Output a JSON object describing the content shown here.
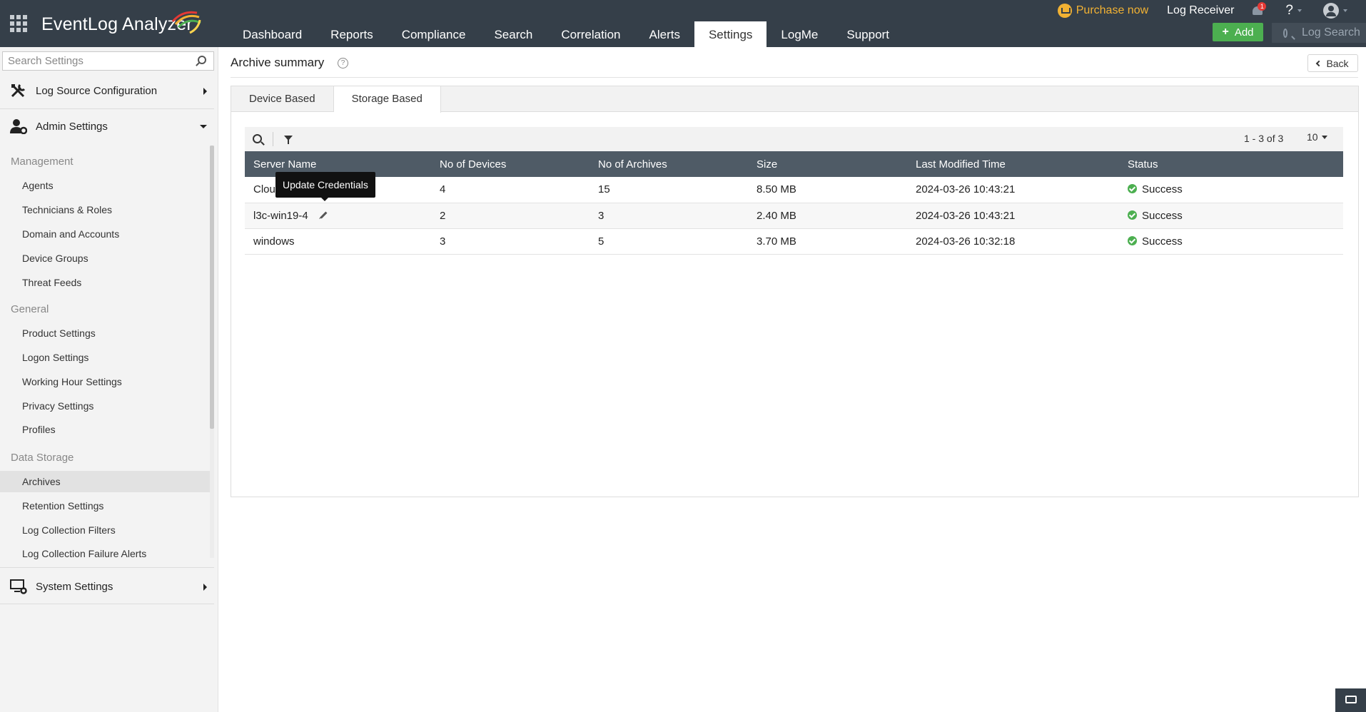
{
  "app": {
    "logo": "EventLog Analyzer"
  },
  "nav": {
    "items": [
      "Dashboard",
      "Reports",
      "Compliance",
      "Search",
      "Correlation",
      "Alerts",
      "Settings",
      "LogMe",
      "Support"
    ],
    "active": "Settings"
  },
  "topbar": {
    "purchase": "Purchase now",
    "log_receiver": "Log Receiver",
    "notification_count": "1",
    "help": "?",
    "add_label": "Add",
    "log_search_placeholder": "Log Search"
  },
  "sidebar": {
    "search_placeholder": "Search Settings",
    "sections": {
      "log_source": "Log Source Configuration",
      "admin": "Admin Settings",
      "system": "System Settings"
    },
    "groups": {
      "management": "Management",
      "general": "General",
      "data_storage": "Data Storage"
    },
    "management_items": [
      "Agents",
      "Technicians & Roles",
      "Domain and Accounts",
      "Device Groups",
      "Threat Feeds"
    ],
    "general_items": [
      "Product Settings",
      "Logon Settings",
      "Working Hour Settings",
      "Privacy Settings",
      "Profiles"
    ],
    "data_storage_items": [
      "Archives",
      "Retention Settings",
      "Log Collection Filters",
      "Log Collection Failure Alerts"
    ],
    "active_item": "Archives"
  },
  "page": {
    "title": "Archive summary",
    "back_label": "Back",
    "tabs": [
      "Device Based",
      "Storage Based"
    ],
    "active_tab": "Storage Based"
  },
  "table": {
    "count_text": "1 - 3 of 3",
    "page_size": "10",
    "columns": [
      "Server Name",
      "No of Devices",
      "No of Archives",
      "Size",
      "Last Modified Time",
      "Status"
    ],
    "rows": [
      {
        "server": "Clou",
        "devices": "4",
        "archives": "15",
        "size": "8.50 MB",
        "modified": "2024-03-26 10:43:21",
        "status": "Success"
      },
      {
        "server": "l3c-win19-4",
        "devices": "2",
        "archives": "3",
        "size": "2.40 MB",
        "modified": "2024-03-26 10:43:21",
        "status": "Success"
      },
      {
        "server": "windows",
        "devices": "3",
        "archives": "5",
        "size": "3.70 MB",
        "modified": "2024-03-26 10:32:18",
        "status": "Success"
      }
    ],
    "tooltip": "Update Credentials"
  },
  "colors": {
    "topbar": "#353f49",
    "table_header": "#4f5b66",
    "add_button": "#4caf50",
    "purchase": "#f2b233",
    "success": "#4caf50"
  }
}
